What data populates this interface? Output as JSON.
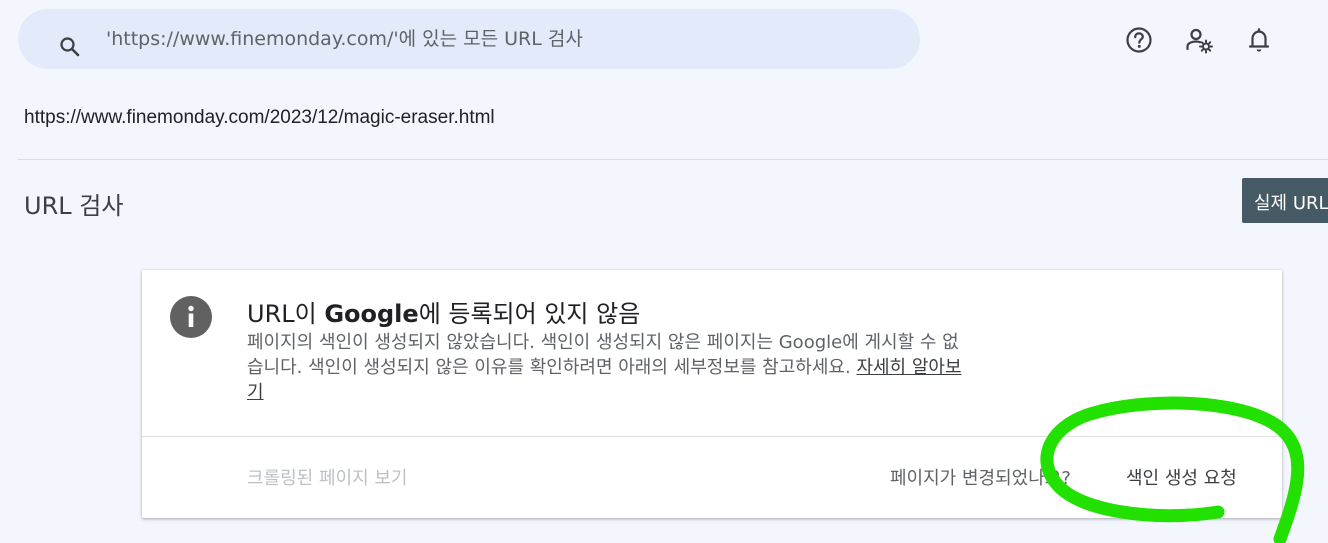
{
  "search": {
    "placeholder": "'https://www.finemonday.com/'에 있는 모든 URL 검사",
    "icon": "search-icon"
  },
  "header_icons": [
    "help-icon",
    "manage-users-icon",
    "notifications-icon"
  ],
  "inspected_url": "https://www.finemonday.com/2023/12/magic-eraser.html",
  "page": {
    "title": "URL 검사",
    "test_live_label": "실제 URL"
  },
  "status_card": {
    "title_prefix": "URL이 ",
    "title_brand": "Google",
    "title_suffix": "에 등록되어 있지 않음",
    "description": "페이지의 색인이 생성되지 않았습니다. 색인이 생성되지 않은 페이지는 Google에 게시할 수 없습니다. 색인이 생성되지 않은 이유를 확인하려면 아래의 세부정보를 참고하세요.",
    "learn_more": "자세히 알아보기",
    "view_crawled": "크롤링된 페이지 보기",
    "changed_question": "페이지가 변경되었나요?",
    "request_indexing": "색인 생성 요청"
  },
  "colors": {
    "background": "#f3f6fc",
    "search_bg": "#e3ebfa",
    "button_dark": "#455a64",
    "info_icon": "#616161",
    "annotation": "#22e000"
  }
}
